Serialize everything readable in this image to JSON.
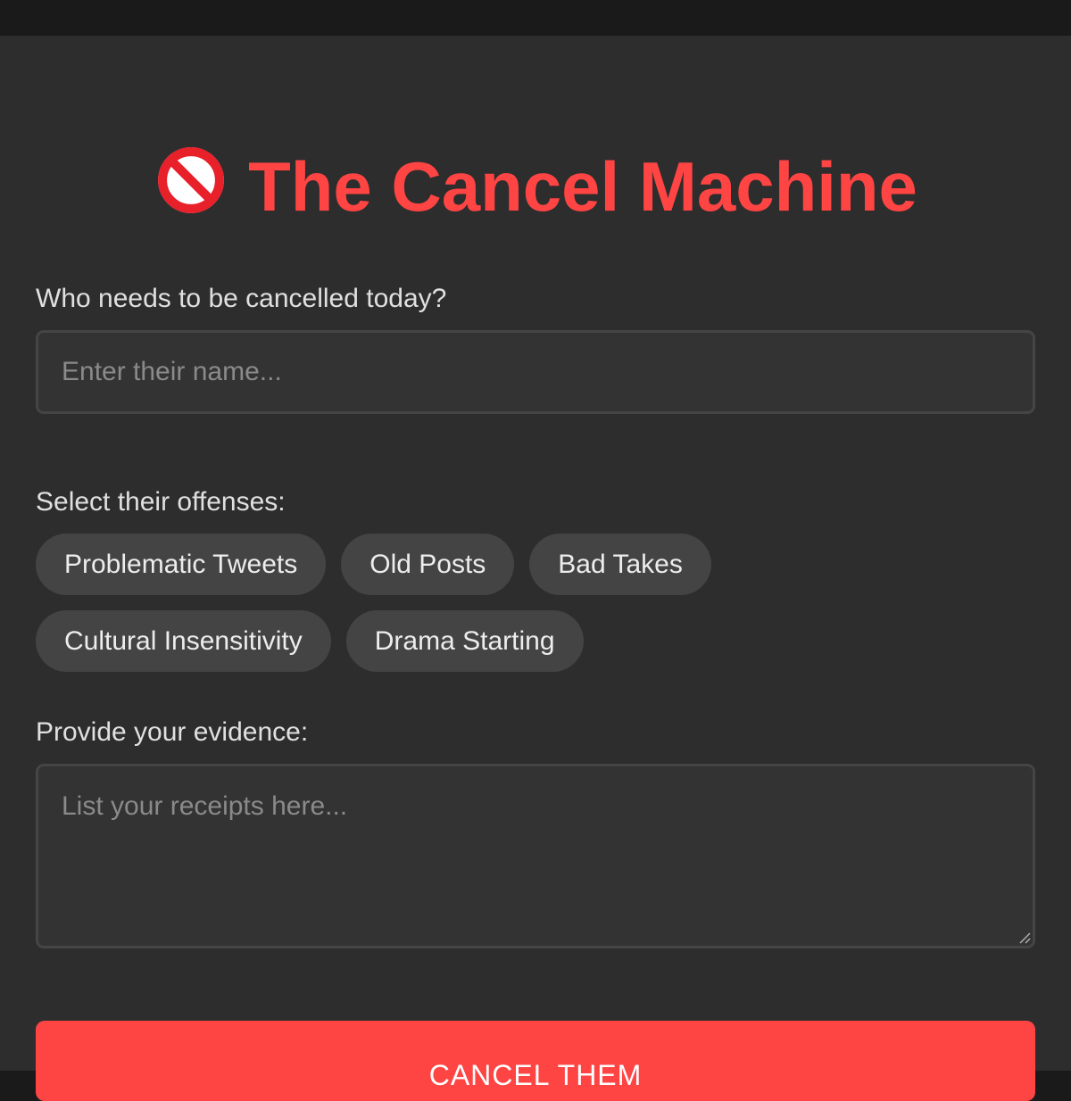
{
  "app": {
    "title": "The Cancel Machine",
    "title_icon": "no-entry-icon",
    "accent_color": "#ff4444"
  },
  "target": {
    "label": "Who needs to be cancelled today?",
    "value": "",
    "placeholder": "Enter their name..."
  },
  "offenses": {
    "label": "Select their offenses:",
    "options": [
      "Problematic Tweets",
      "Old Posts",
      "Bad Takes",
      "Cultural Insensitivity",
      "Drama Starting"
    ]
  },
  "evidence": {
    "label": "Provide your evidence:",
    "value": "",
    "placeholder": "List your receipts here..."
  },
  "submit": {
    "label": "CANCEL THEM"
  }
}
